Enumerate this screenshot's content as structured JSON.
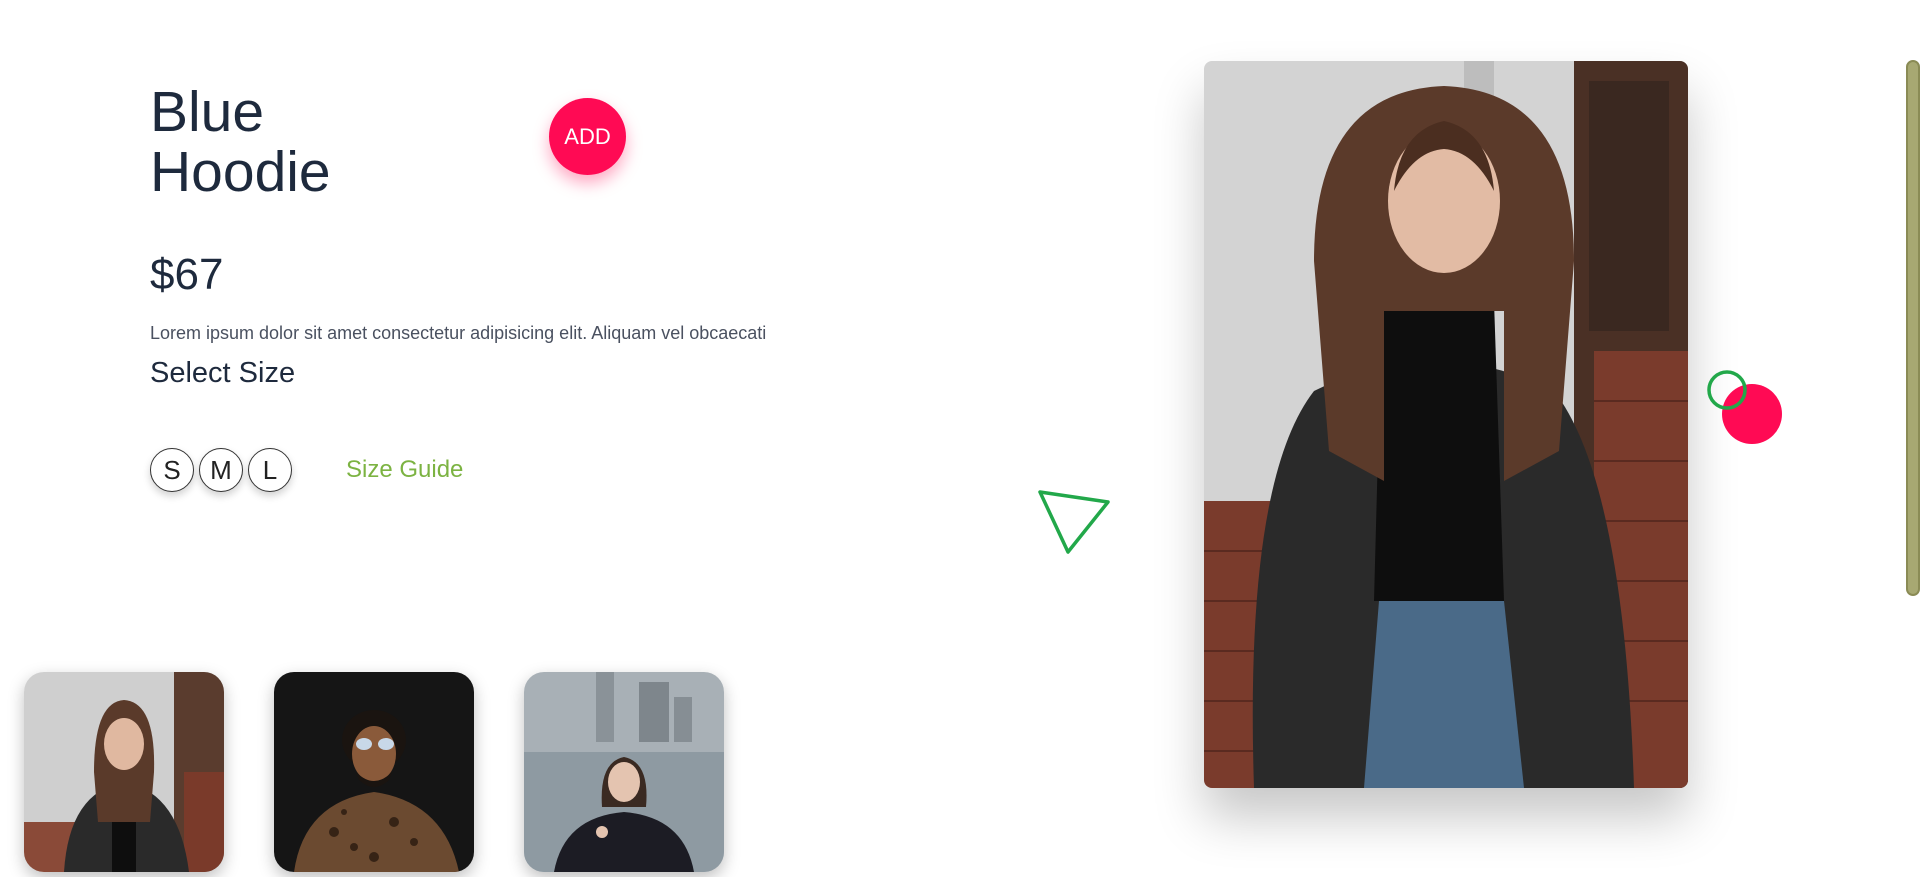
{
  "product": {
    "title_line1": "Blue",
    "title_line2": "Hoodie",
    "price": "$67",
    "description": "Lorem ipsum dolor sit amet consectetur adipisicing elit. Aliquam vel obcaecati"
  },
  "actions": {
    "add_label": "ADD"
  },
  "size_selector": {
    "heading": "Select Size",
    "options": [
      "S",
      "M",
      "L"
    ],
    "guide_label": "Size Guide"
  },
  "colors": {
    "accent": "#ff0a54",
    "guide_green": "#7cb342",
    "deco_green": "#22a84a",
    "text_dark": "#1e2a3d"
  },
  "images": {
    "main": "woman-in-black-leather-coat-photo",
    "thumbnails": [
      "woman-in-black-leather-coat-thumb",
      "man-in-sunglasses-leopard-shirt-thumb",
      "woman-by-harbor-city-thumb"
    ]
  },
  "decorations": [
    "green-triangle-outline",
    "green-ring-outline",
    "pink-circle"
  ]
}
